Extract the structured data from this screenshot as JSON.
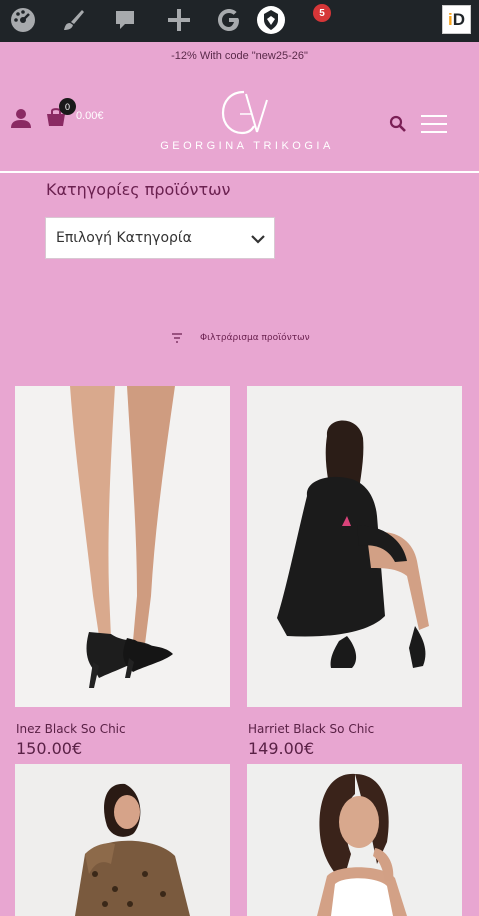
{
  "admin_bar": {
    "icons": [
      "dashboard-icon",
      "customize-brush-icon",
      "comments-icon",
      "add-new-icon",
      "google-site-kit-icon",
      "plugin-shield-icon",
      "id-logo-icon"
    ],
    "notification_count": "5",
    "id_logo": {
      "first": "i",
      "second": "D"
    }
  },
  "promo": {
    "text": "-12% With code \"new25-26\""
  },
  "header": {
    "cart_count": "0",
    "cart_total": "0.00€",
    "logo_text": "GEORGINA TRIKOGIA"
  },
  "categories": {
    "title": "Κατηγορίες προϊόντων",
    "select_value": "Επιλογή Κατηγορία"
  },
  "filter": {
    "label": "Φιλτράρισμα προϊόντων"
  },
  "products": [
    {
      "name": "Inez Black So Chic",
      "price": "150.00€"
    },
    {
      "name": "Harriet Black So Chic",
      "price": "149.00€"
    },
    {
      "name": "",
      "price": ""
    },
    {
      "name": "",
      "price": ""
    }
  ],
  "colors": {
    "background": "#e8a6d1",
    "admin_bar": "#1f2428",
    "text_plum": "#5a2146",
    "badge_red": "#d63638"
  }
}
